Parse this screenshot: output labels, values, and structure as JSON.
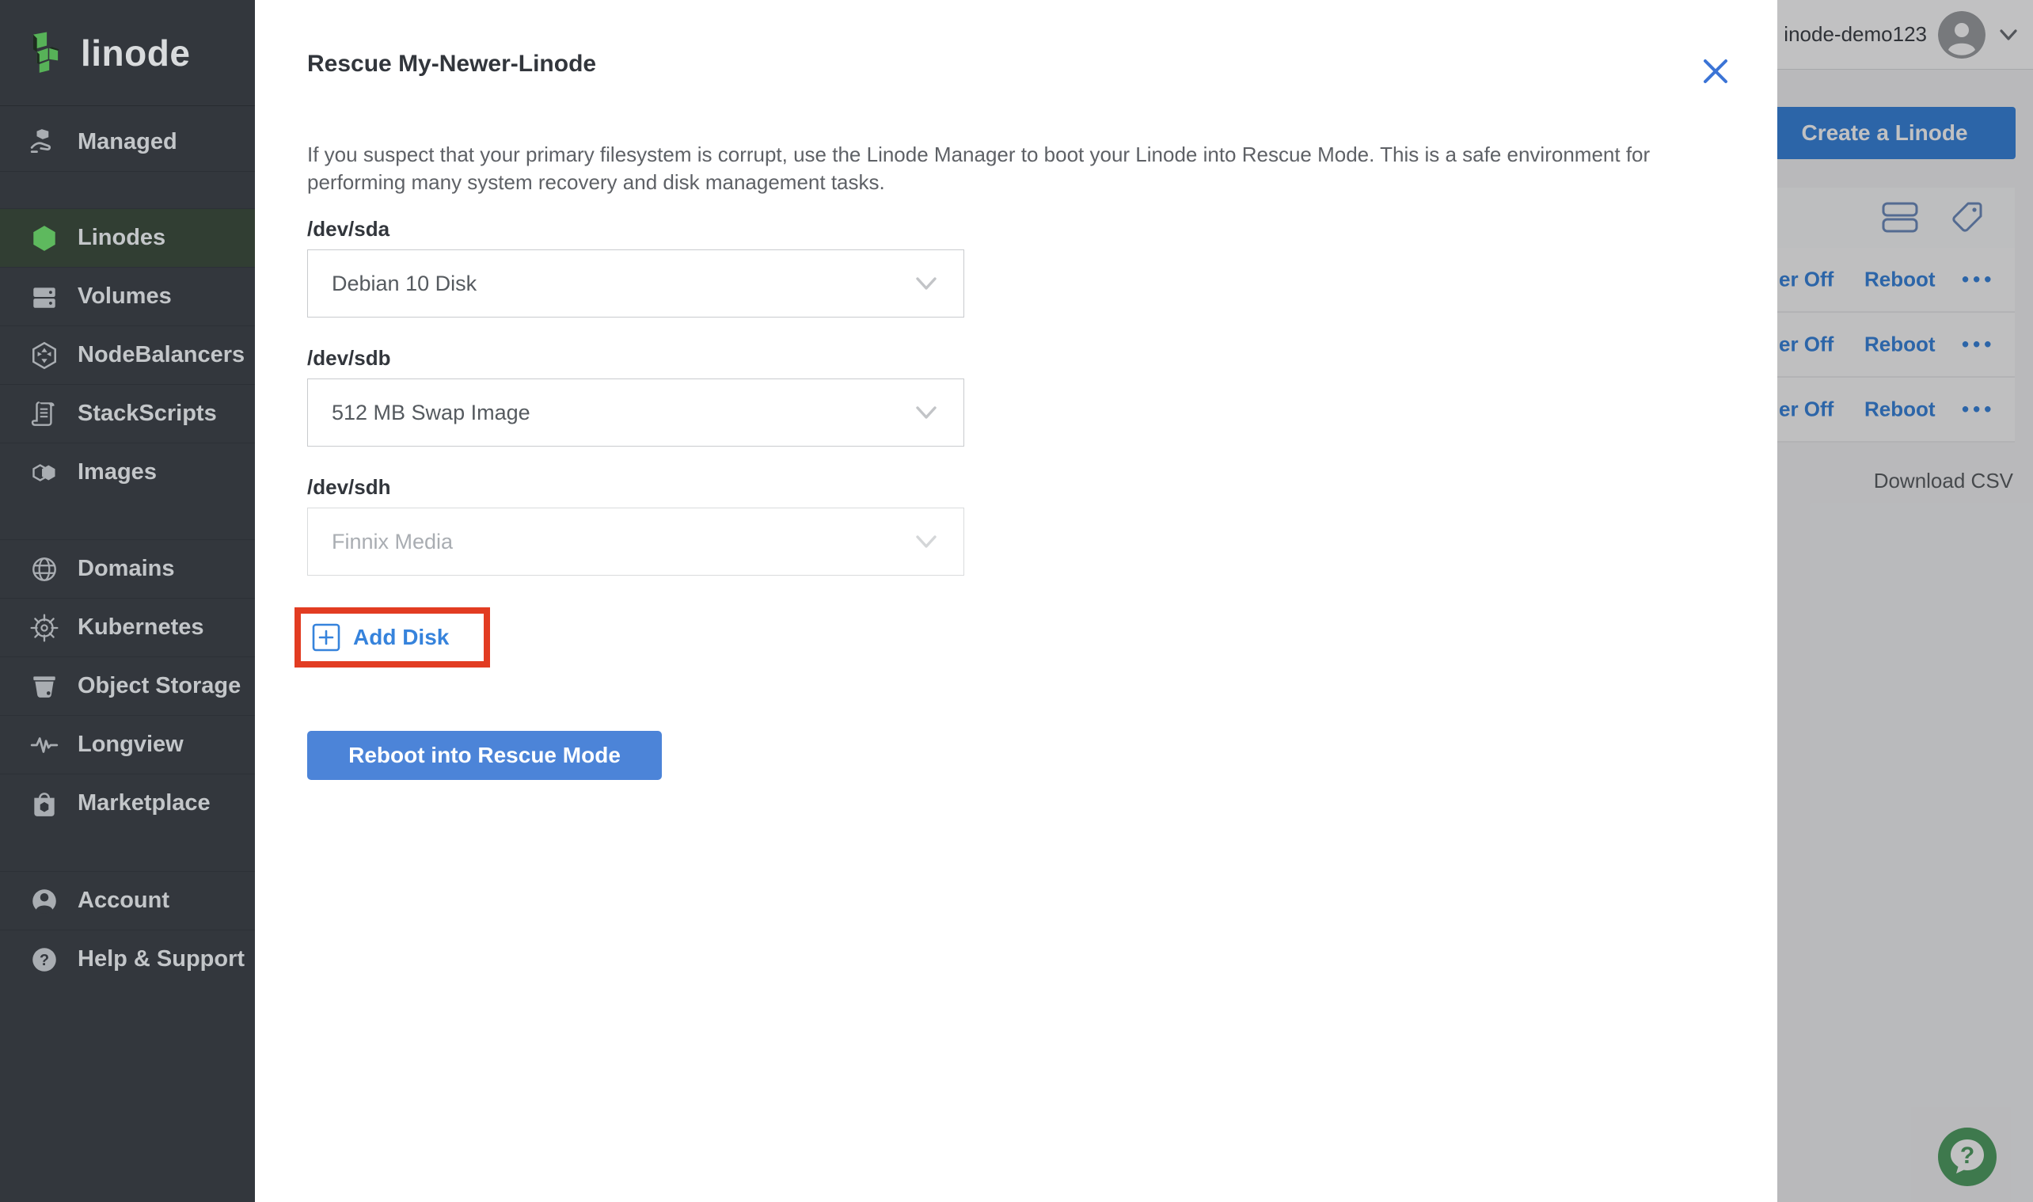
{
  "colors": {
    "accent_blue": "#3683dc",
    "button_blue": "#4c84d8",
    "sidebar_bg": "#33373d",
    "linode_green": "#5eb95e",
    "annotation_red": "#e23c22",
    "help_green": "#4f9e62"
  },
  "sidebar": {
    "logo_text": "linode",
    "items": [
      {
        "label": "Managed",
        "icon": "managed-icon"
      },
      {
        "label": "Linodes",
        "icon": "linodes-icon",
        "selected": true
      },
      {
        "label": "Volumes",
        "icon": "volumes-icon"
      },
      {
        "label": "NodeBalancers",
        "icon": "nodebalancers-icon"
      },
      {
        "label": "StackScripts",
        "icon": "stackscripts-icon"
      },
      {
        "label": "Images",
        "icon": "images-icon"
      },
      {
        "label": "Domains",
        "icon": "domains-icon"
      },
      {
        "label": "Kubernetes",
        "icon": "kubernetes-icon"
      },
      {
        "label": "Object Storage",
        "icon": "object-storage-icon"
      },
      {
        "label": "Longview",
        "icon": "longview-icon"
      },
      {
        "label": "Marketplace",
        "icon": "marketplace-icon"
      },
      {
        "label": "Account",
        "icon": "account-icon"
      },
      {
        "label": "Help & Support",
        "icon": "help-icon"
      }
    ]
  },
  "drawer": {
    "title": "Rescue My-Newer-Linode",
    "description": "If you suspect that your primary filesystem is corrupt, use the Linode Manager to boot your Linode into Rescue Mode. This is a safe environment for performing many system recovery and disk management tasks.",
    "fields": [
      {
        "label": "/dev/sda",
        "value": "Debian 10 Disk",
        "disabled": false
      },
      {
        "label": "/dev/sdb",
        "value": "512 MB Swap Image",
        "disabled": false
      },
      {
        "label": "/dev/sdh",
        "value": "Finnix Media",
        "disabled": true
      }
    ],
    "add_disk_label": "Add Disk",
    "submit_label": "Reboot into Rescue Mode"
  },
  "background": {
    "username": "inode-demo123",
    "create_button_label": "Create a Linode",
    "rows": [
      {
        "power_label": "er Off",
        "reboot_label": "Reboot",
        "more_label": "•••"
      },
      {
        "power_label": "er Off",
        "reboot_label": "Reboot",
        "more_label": "•••"
      },
      {
        "power_label": "er Off",
        "reboot_label": "Reboot",
        "more_label": "•••"
      }
    ],
    "download_csv_label": "Download CSV"
  }
}
